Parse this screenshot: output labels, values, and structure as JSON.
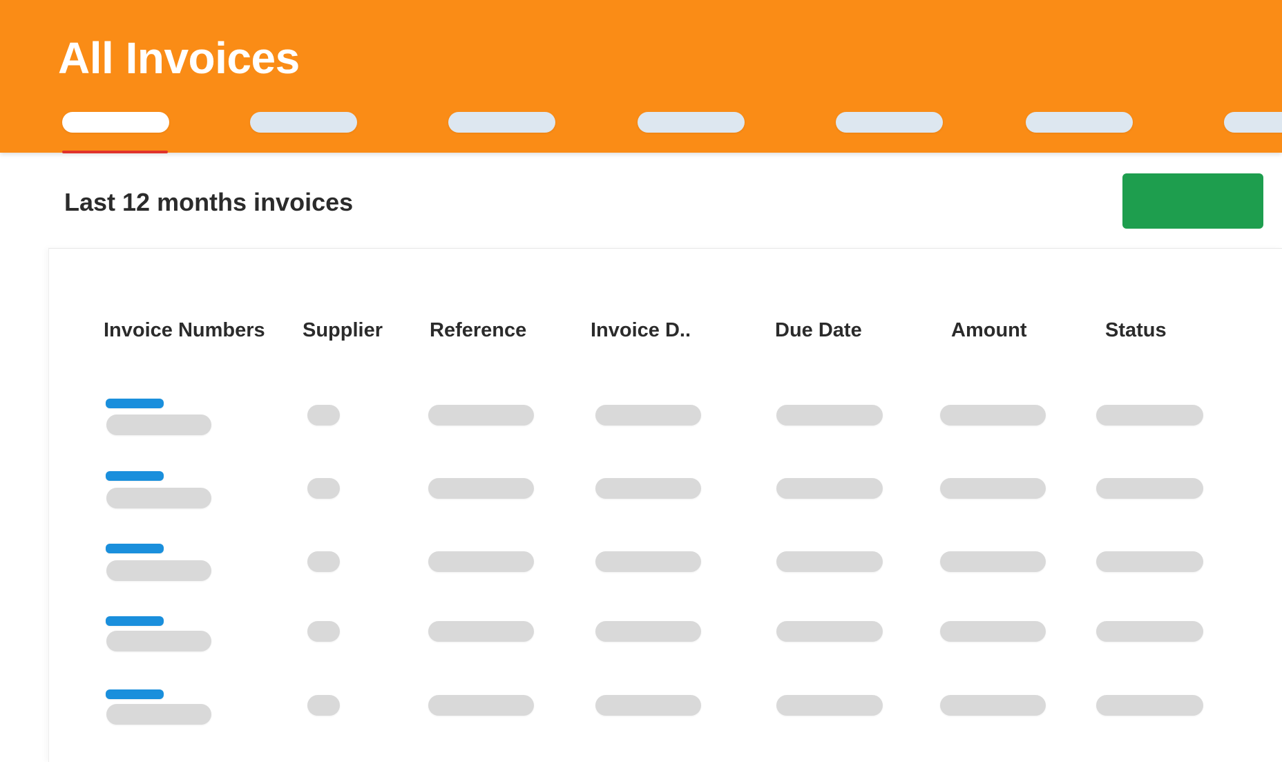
{
  "header": {
    "title": "All Invoices",
    "background_color": "#fa8c16",
    "tabs": [
      {
        "active": true
      },
      {
        "active": false
      },
      {
        "active": false
      },
      {
        "active": false
      },
      {
        "active": false
      },
      {
        "active": false
      },
      {
        "active": false
      }
    ],
    "active_indicator_color": "#e0322b"
  },
  "section": {
    "title": "Last 12 months invoices",
    "action_button_color": "#1e9e4e"
  },
  "table": {
    "columns": [
      "Invoice Numbers",
      "Supplier",
      "Reference",
      "Invoice D..",
      "Due Date",
      "Amount",
      "Status"
    ],
    "row_count": 5,
    "link_color": "#1a8fdc",
    "placeholder_color": "#d9d9d9"
  }
}
